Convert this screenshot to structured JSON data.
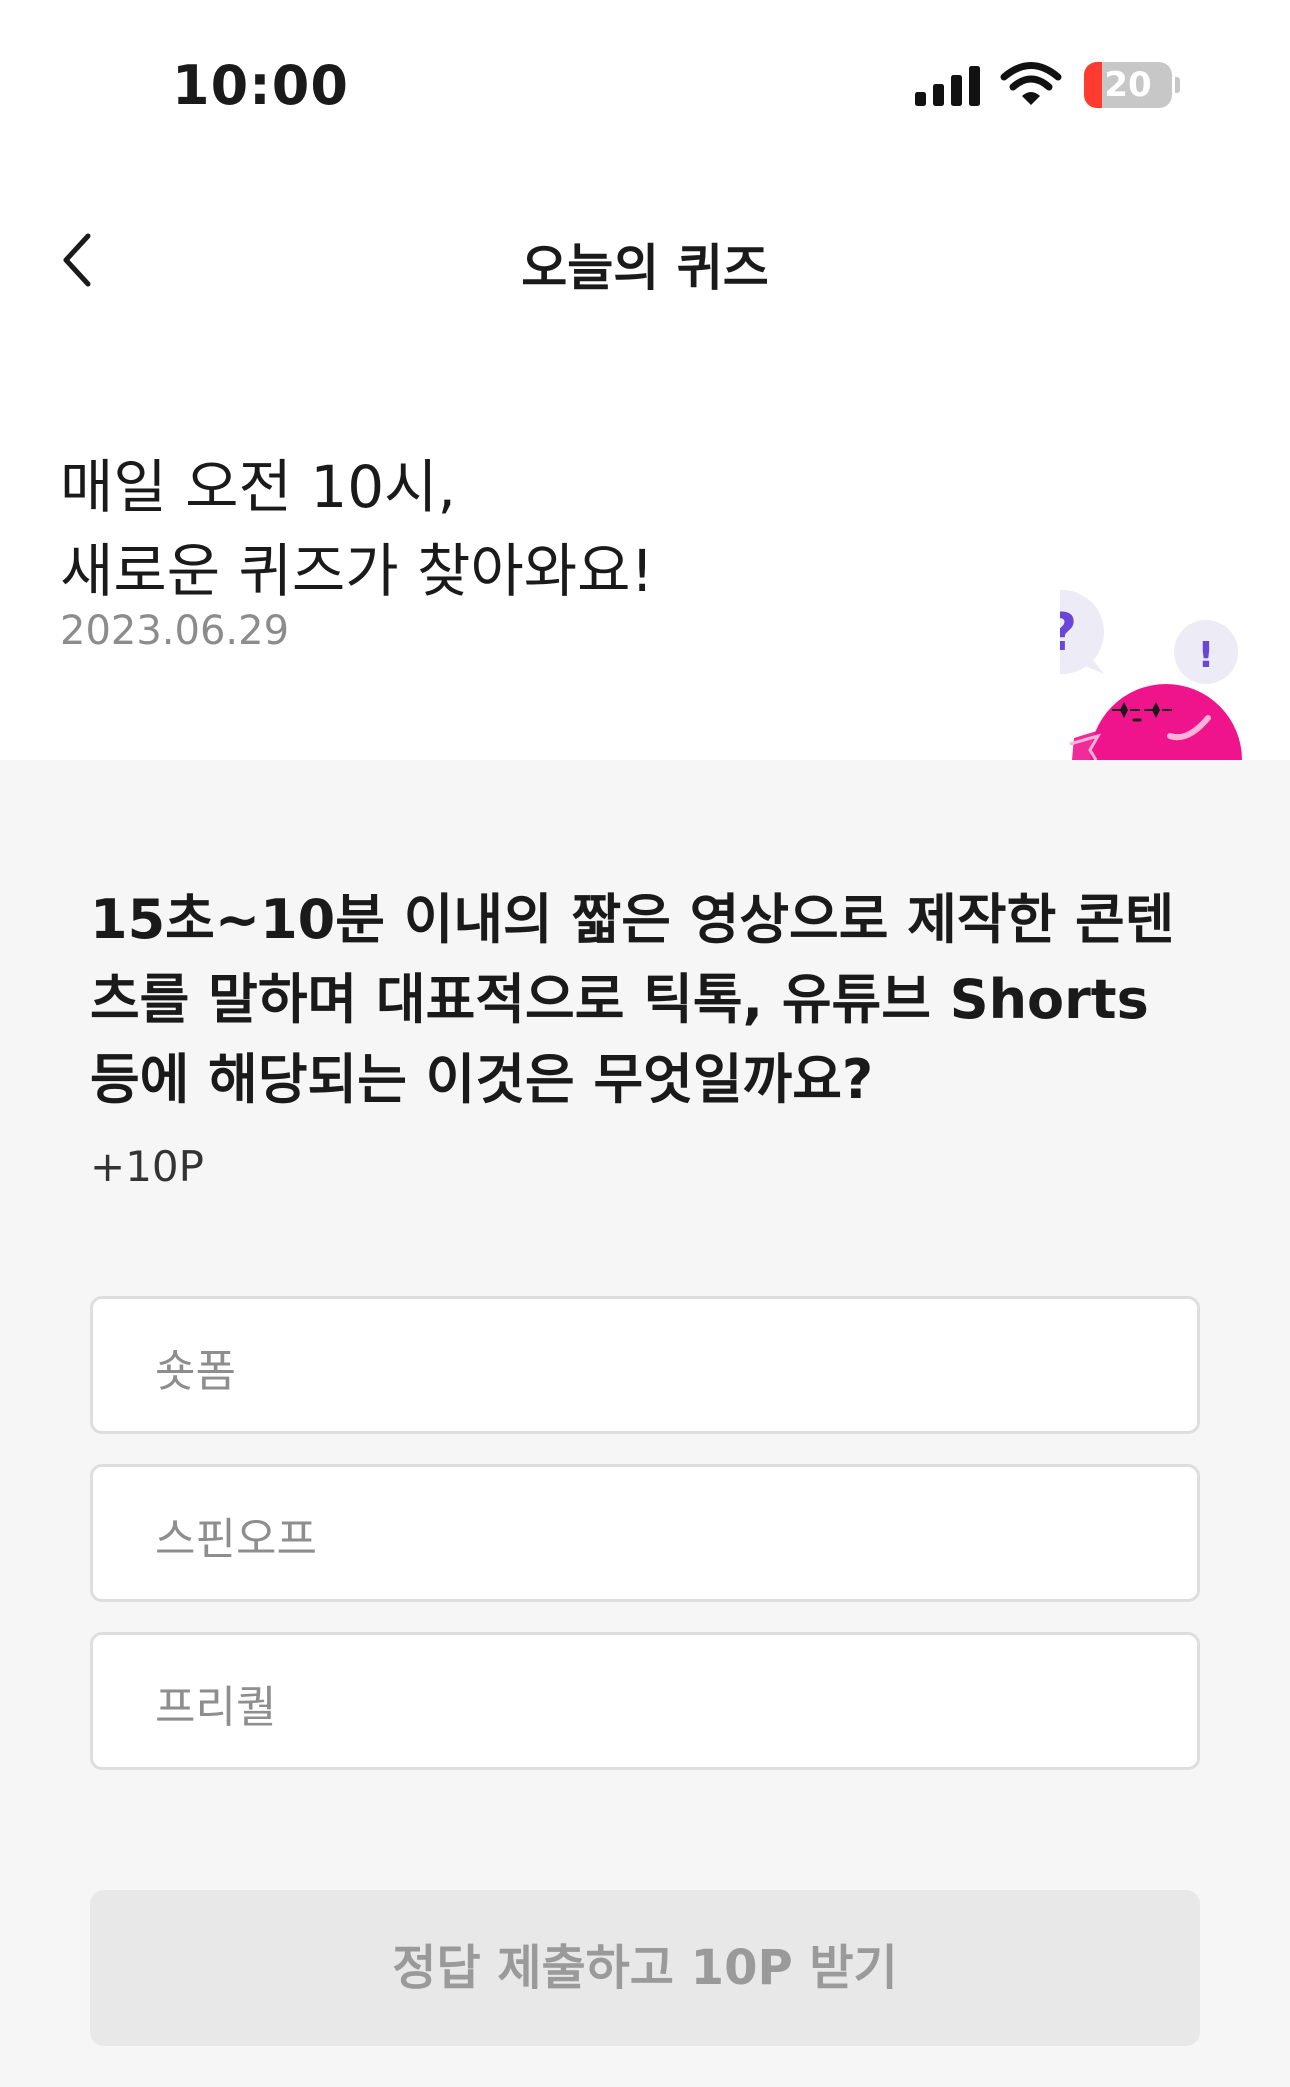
{
  "status_bar": {
    "time": "10:00",
    "battery_level": "20",
    "battery_fraction": 0.2,
    "icons": [
      "signal-icon",
      "wifi-icon",
      "battery-icon"
    ]
  },
  "nav": {
    "back_icon": "chevron-left-icon",
    "title": "오늘의 퀴즈"
  },
  "hero": {
    "line1": "매일 오전 10시,",
    "line2": "새로운 퀴즈가 찾아와요!",
    "date": "2023.06.29",
    "mascot_marks": [
      "?",
      "!"
    ]
  },
  "quiz": {
    "question": "15초~10분 이내의 짧은 영상으로 제작한 콘텐츠를 말하며 대표적으로 틱톡, 유튜브 Shorts 등에 해당되는 이것은 무엇일까요?",
    "points": "+10P",
    "options": [
      "숏폼",
      "스핀오프",
      "프리퀄"
    ],
    "submit_label": "정답 제출하고 10P 받기"
  },
  "colors": {
    "mascot_pink": "#f0148c",
    "mark_purple": "#6a45d6",
    "battery_red": "#ff3b30",
    "panel_bg": "#f6f6f6"
  }
}
